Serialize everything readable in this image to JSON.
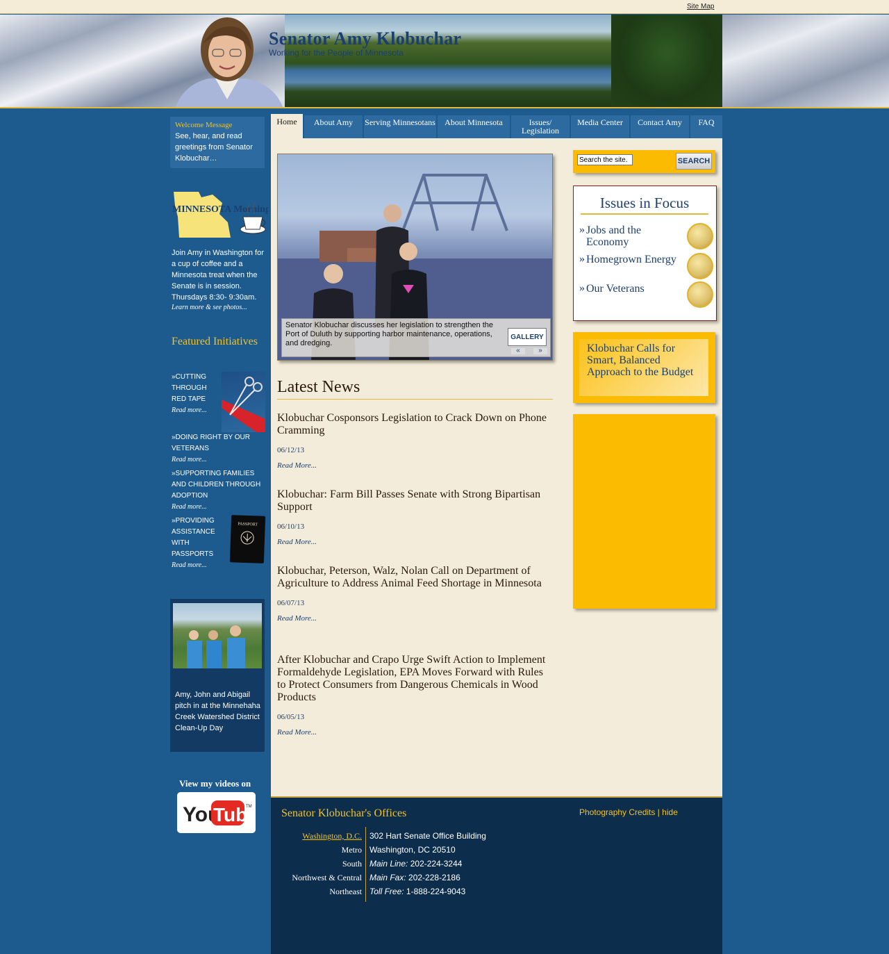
{
  "topbar": {
    "site_map": "Site Map"
  },
  "header": {
    "title": "Senator Amy Klobuchar",
    "subtitle": "Working for the People of Minnesota"
  },
  "nav": {
    "tabs": [
      {
        "label": "Home",
        "active": true
      },
      {
        "label": "About Amy"
      },
      {
        "label": "Serving Minnesotans"
      },
      {
        "label": "About Minnesota"
      },
      {
        "label": "Issues/ Legislation"
      },
      {
        "label": "Media Center"
      },
      {
        "label": "Contact Amy"
      },
      {
        "label": "FAQ"
      }
    ]
  },
  "welcome": {
    "title": "Welcome Message",
    "text": "See, hear, and read greetings from Senator Klobuchar…"
  },
  "minnesota_morning": {
    "logo_text": "MINNESOTA Morning",
    "text": "Join Amy in Washington for a cup of coffee and a Minnesota treat when the Senate is in session. Thursdays 8:30- 9:30am.",
    "link": "Learn more & see photos..."
  },
  "featured": {
    "title": "Featured Initiatives",
    "items": [
      {
        "label": "»CUTTING THROUGH RED TAPE",
        "more": "Read more..."
      },
      {
        "label": "»DOING RIGHT BY OUR VETERANS",
        "more": "Read more..."
      },
      {
        "label": "»SUPPORTING FAMILIES AND CHILDREN THROUGH ADOPTION",
        "more": "Read more..."
      },
      {
        "label": "»PROVIDING ASSISTANCE WITH PASSPORTS",
        "more": "Read more..."
      }
    ],
    "passport_text": "PASSPORT"
  },
  "photo": {
    "caption": "Amy, John and Abigail pitch in at the Minnehaha Creek Watershed District Clean-Up Day"
  },
  "youtube": {
    "label": "View my videos on",
    "logo_you": "You",
    "logo_tube": "Tube",
    "logo_tm": "TM"
  },
  "slideshow": {
    "caption": "Senator Klobuchar discusses her legislation to strengthen the Port of Duluth by supporting harbor maintenance, operations, and dredging.",
    "gallery": "GALLERY",
    "prev": "«",
    "next": "»"
  },
  "news": {
    "heading": "Latest News",
    "items": [
      {
        "title": "Klobuchar Cosponsors Legislation to Crack Down on Phone Cramming",
        "date": "06/12/13",
        "more": "Read More..."
      },
      {
        "title": "Klobuchar: Farm Bill Passes Senate with Strong Bipartisan Support",
        "date": "06/10/13",
        "more": "Read More..."
      },
      {
        "title": "Klobuchar, Peterson, Walz, Nolan Call on Department of Agriculture to Address Animal Feed Shortage in Minnesota",
        "date": "06/07/13",
        "more": "Read More..."
      },
      {
        "title": "After Klobuchar and Crapo Urge Swift Action to Implement Formaldehyde Legislation, EPA Moves Forward with Rules to Protect Consumers from Dangerous Chemicals in Wood Products",
        "date": "06/05/13",
        "more": "Read More..."
      }
    ]
  },
  "search": {
    "value": "Search the site.",
    "button": "SEARCH"
  },
  "focus": {
    "title": "Issues in Focus",
    "items": [
      {
        "label": "Jobs and the Economy",
        "icon": "coins-icon"
      },
      {
        "label": "Homegrown Energy",
        "icon": "wind-turbine-icon"
      },
      {
        "label": "Our Veterans",
        "icon": "helmet-icon"
      }
    ]
  },
  "budget": {
    "text": "Klobuchar Calls for Smart, Balanced Approach to the Budget"
  },
  "footer": {
    "offices_title": "Senator Klobuchar's Offices",
    "photo_credits": "Photography Credits | hide",
    "offices": [
      "Washington, D.C.",
      "Metro",
      "South",
      "Northwest & Central",
      "Northeast"
    ],
    "details": {
      "address1": "302 Hart Senate Office Building",
      "address2": "Washington, DC 20510",
      "main_line_label": "Main Line:",
      "main_line": "202-224-3244",
      "main_fax_label": "Main Fax:",
      "main_fax": "202-228-2186",
      "toll_free_label": "Toll Free:",
      "toll_free": "1-888-224-9043"
    }
  },
  "colors": {
    "page_blue": "#1d5a8e",
    "panel_blue": "#2c6aa0",
    "gold": "#fbbb00",
    "title_gold": "#f2c227",
    "navy_text": "#1b3f6f",
    "main_bg": "#f3ecda",
    "footer_bg": "#0d2d4d"
  }
}
